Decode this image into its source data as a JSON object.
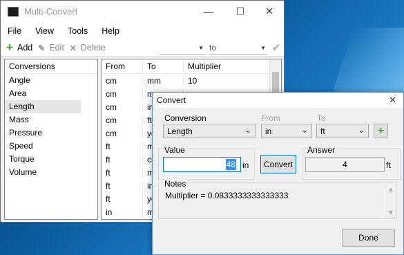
{
  "window": {
    "title": "Multi-Convert"
  },
  "menu": [
    "File",
    "View",
    "Tools",
    "Help"
  ],
  "toolbar": {
    "add": "Add",
    "edit": "Edit",
    "delete": "Delete",
    "to": "to"
  },
  "conversions": {
    "header": "Conversions",
    "items": [
      "Angle",
      "Area",
      "Length",
      "Mass",
      "Pressure",
      "Speed",
      "Torque",
      "Volume"
    ],
    "selected": "Length"
  },
  "grid": {
    "columns": [
      "From",
      "To",
      "Multiplier"
    ],
    "rows": [
      [
        "cm",
        "mm",
        "10"
      ],
      [
        "cm",
        "m",
        ""
      ],
      [
        "cm",
        "in",
        ""
      ],
      [
        "cm",
        "ft",
        ""
      ],
      [
        "cm",
        "yd",
        ""
      ],
      [
        "ft",
        "m",
        ""
      ],
      [
        "ft",
        "cm",
        ""
      ],
      [
        "ft",
        "m",
        ""
      ],
      [
        "ft",
        "in",
        ""
      ],
      [
        "ft",
        "yd",
        ""
      ],
      [
        "in",
        "m",
        ""
      ]
    ]
  },
  "dialog": {
    "title": "Convert",
    "conversion_label": "Conversion",
    "conversion_value": "Length",
    "from_label": "From",
    "from_value": "in",
    "to_label": "To",
    "to_value": "ft",
    "value_label": "Value",
    "value": "48",
    "value_unit": "in",
    "convert_button": "Convert",
    "answer_label": "Answer",
    "answer": "4",
    "answer_unit": "ft",
    "notes_label": "Notes",
    "notes_text": "Multiplier = 0.0833333333333333",
    "done_button": "Done"
  },
  "icons": {
    "add": "plus-icon",
    "edit": "edit-icon",
    "delete": "delete-icon",
    "apply": "checkmark-icon",
    "add_unit": "plus-icon"
  },
  "colors": {
    "accent": "#0078d7",
    "add_green": "#3fa83a",
    "selection": "#3390ff"
  }
}
